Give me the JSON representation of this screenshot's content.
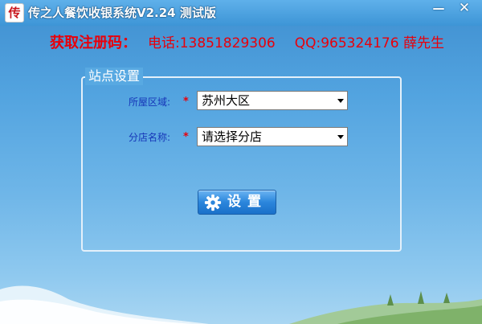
{
  "window": {
    "logo_char": "传",
    "title": "传之人餐饮收银系统V2.24 测试版",
    "minimize_glyph": "—",
    "close_glyph": "✕"
  },
  "registration": {
    "label": "获取注册码：",
    "phone": "电话:13851829306",
    "qq": "QQ:965324176 薛先生"
  },
  "site_settings": {
    "group_title": "站点设置",
    "region_label": "所屋区域:",
    "region_required": "*",
    "region_value": "苏州大区",
    "branch_label": "分店名称:",
    "branch_required": "*",
    "branch_value": "请选择分店",
    "settings_button": "设置"
  },
  "icons": {
    "settings_button_icon": "gear-icon",
    "dropdown_icon": "chevron-down-icon"
  },
  "colors": {
    "title_bar": "#3d95d6",
    "registration_text": "#e8000b",
    "field_label": "#1636b8",
    "button": "#2b86dc"
  }
}
